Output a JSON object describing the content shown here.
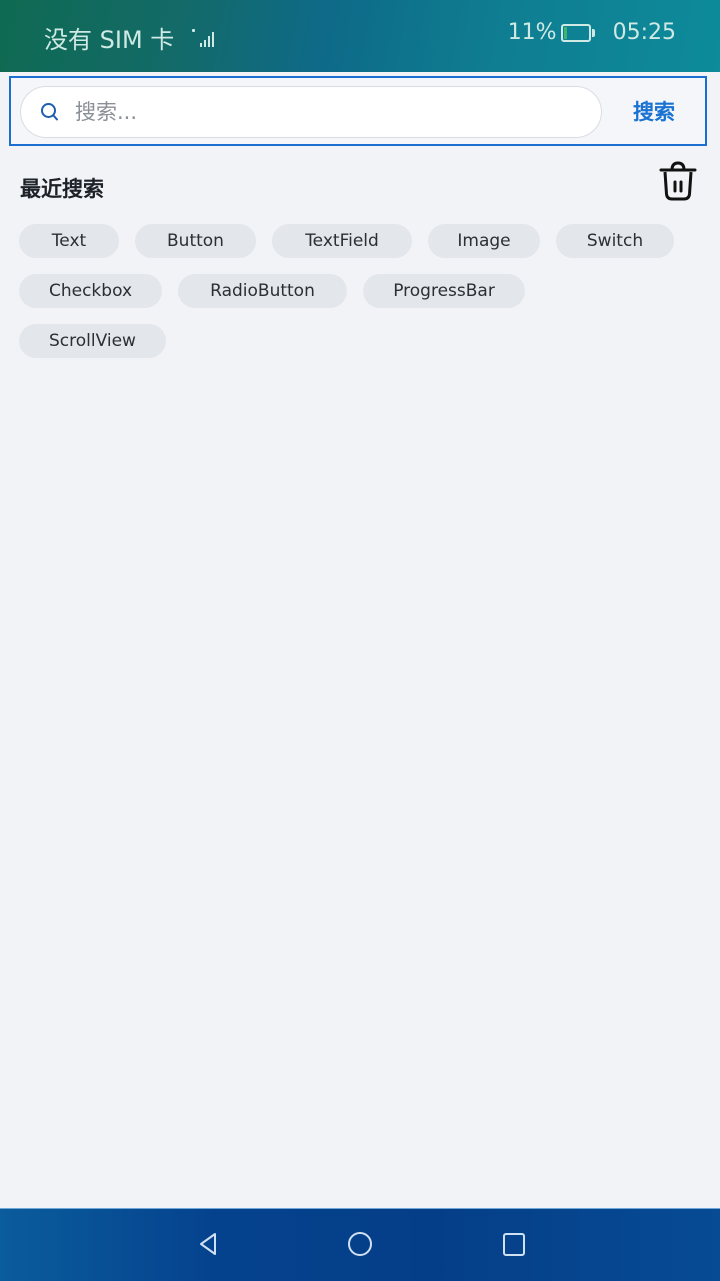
{
  "status_bar": {
    "carrier": "没有 SIM 卡",
    "battery_percent": "11%",
    "time": "05:25"
  },
  "search": {
    "placeholder": "搜索...",
    "value": "",
    "button_label": "搜索"
  },
  "recent": {
    "title": "最近搜索",
    "tag_rows": [
      [
        "Text",
        "Button",
        "TextField",
        "Image",
        "Switch"
      ],
      [
        "Checkbox",
        "RadioButton",
        "ProgressBar"
      ],
      [
        "ScrollView"
      ]
    ]
  },
  "icons": {
    "search": "search-icon",
    "trash": "trash-icon",
    "back": "back-triangle-icon",
    "home": "home-circle-icon",
    "recents": "recents-square-icon"
  },
  "colors": {
    "accent": "#1a72d2",
    "background": "#f1f3f6",
    "tag_bg": "#e3e6ea"
  }
}
